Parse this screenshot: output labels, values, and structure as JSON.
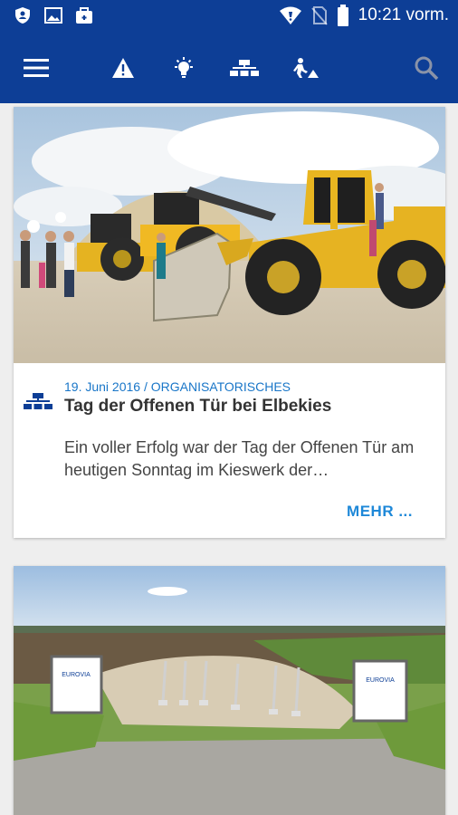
{
  "status_bar": {
    "time": "10:21 vorm."
  },
  "app_bar": {
    "icons": [
      "menu-icon",
      "warning-icon",
      "lightbulb-icon",
      "organisation-icon",
      "construction-icon",
      "search-icon"
    ]
  },
  "articles": [
    {
      "date_category": "19. Juni 2016 / ORGANISATORISCHES",
      "title": "Tag der Offenen Tür bei Elbekies",
      "excerpt": "Ein voller Erfolg war der Tag der Offenen Tür am heutigen Sonntag im Kieswerk der…",
      "more_label": "MEHR ..."
    },
    {
      "sign_left": "EUROVIA",
      "sign_right": "EUROVIA"
    }
  ],
  "colors": {
    "primary": "#0d3e96",
    "accent": "#1e88d8",
    "meta": "#1976c8"
  }
}
